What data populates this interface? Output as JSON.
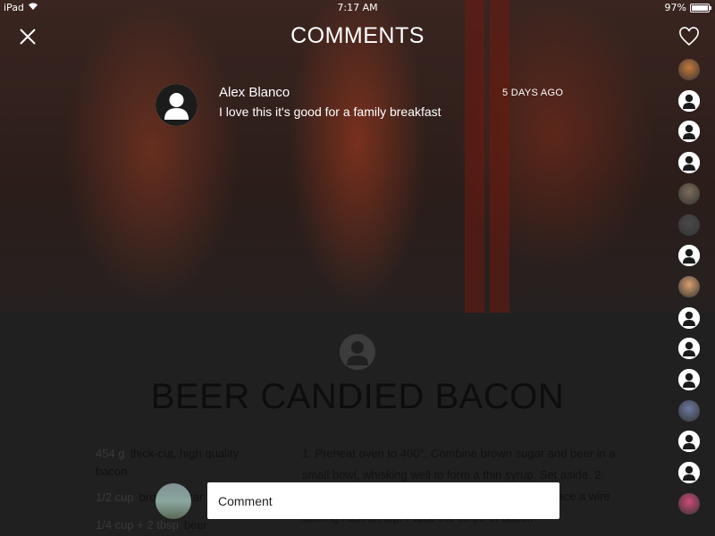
{
  "status_bar": {
    "device": "iPad",
    "time": "7:17 AM",
    "battery": "97%"
  },
  "header": {
    "title": "COMMENTS"
  },
  "comment": {
    "author": "Alex Blanco",
    "time": "5 DAYS AGO",
    "text": "I love this it's good for a family breakfast"
  },
  "sidebar": {
    "avatars": [
      {
        "kind": "photo",
        "color": "#c47a3a"
      },
      {
        "kind": "default"
      },
      {
        "kind": "default"
      },
      {
        "kind": "default"
      },
      {
        "kind": "photo",
        "color": "#7c6c5a"
      },
      {
        "kind": "photo",
        "color": "#4a4a4a"
      },
      {
        "kind": "default"
      },
      {
        "kind": "photo",
        "color": "#d9a070"
      },
      {
        "kind": "default"
      },
      {
        "kind": "default"
      },
      {
        "kind": "default"
      },
      {
        "kind": "photo",
        "color": "#6b7aa0"
      },
      {
        "kind": "default"
      },
      {
        "kind": "default"
      },
      {
        "kind": "photo",
        "color": "#d04a7a"
      }
    ]
  },
  "recipe": {
    "title": "BEER CANDIED BACON",
    "ingredients": [
      {
        "qty": "454 g",
        "text": "thick-cut, high quality"
      },
      {
        "qty": "",
        "text": "bacon"
      },
      {
        "qty": "1/2 cup",
        "text": "brown sugar"
      },
      {
        "qty": "1/4 cup + 2 tbsp",
        "text": "beer"
      }
    ],
    "steps": "1. Preheat oven to 400°. Combine brown sugar and beer in a small bowl, whisking well to form a thin syrup. Set aside. 2. Line a rimmed baking sheet with aluminum foil. Place a wire cooling rack on top. Place the strips of bacon"
  },
  "composer": {
    "placeholder": "Comment"
  }
}
